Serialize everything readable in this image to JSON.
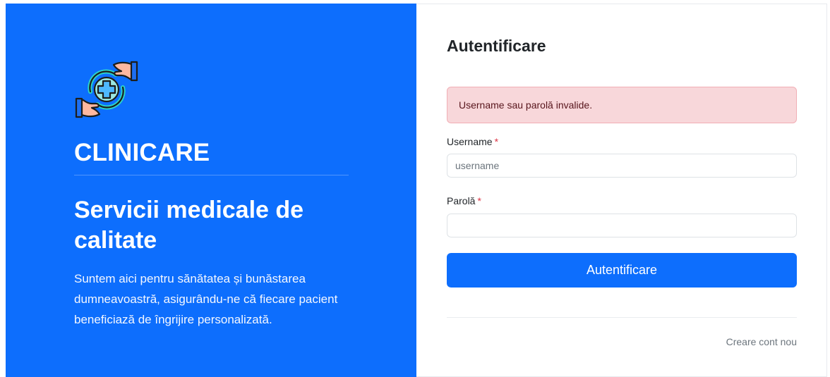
{
  "brand": {
    "logo_icon": "medical-care-hands-icon",
    "name": "CLINICARE",
    "tagline": "Servicii medicale de calitate",
    "description": "Suntem aici pentru sănătatea și bunăstarea dumneavoastră, asigurându-ne că fiecare pacient beneficiază de îngrijire personalizată.",
    "panel_color": "#0d6efd"
  },
  "login": {
    "title": "Autentificare",
    "error_message": "Username sau parolă invalide.",
    "username": {
      "label": "Username",
      "required_mark": "*",
      "placeholder": "username",
      "value": ""
    },
    "password": {
      "label": "Parolă",
      "required_mark": "*",
      "placeholder": "",
      "value": ""
    },
    "submit_label": "Autentificare",
    "register_link": "Creare cont nou",
    "accent_color": "#0d6efd",
    "error_color": "#f8d7da"
  }
}
